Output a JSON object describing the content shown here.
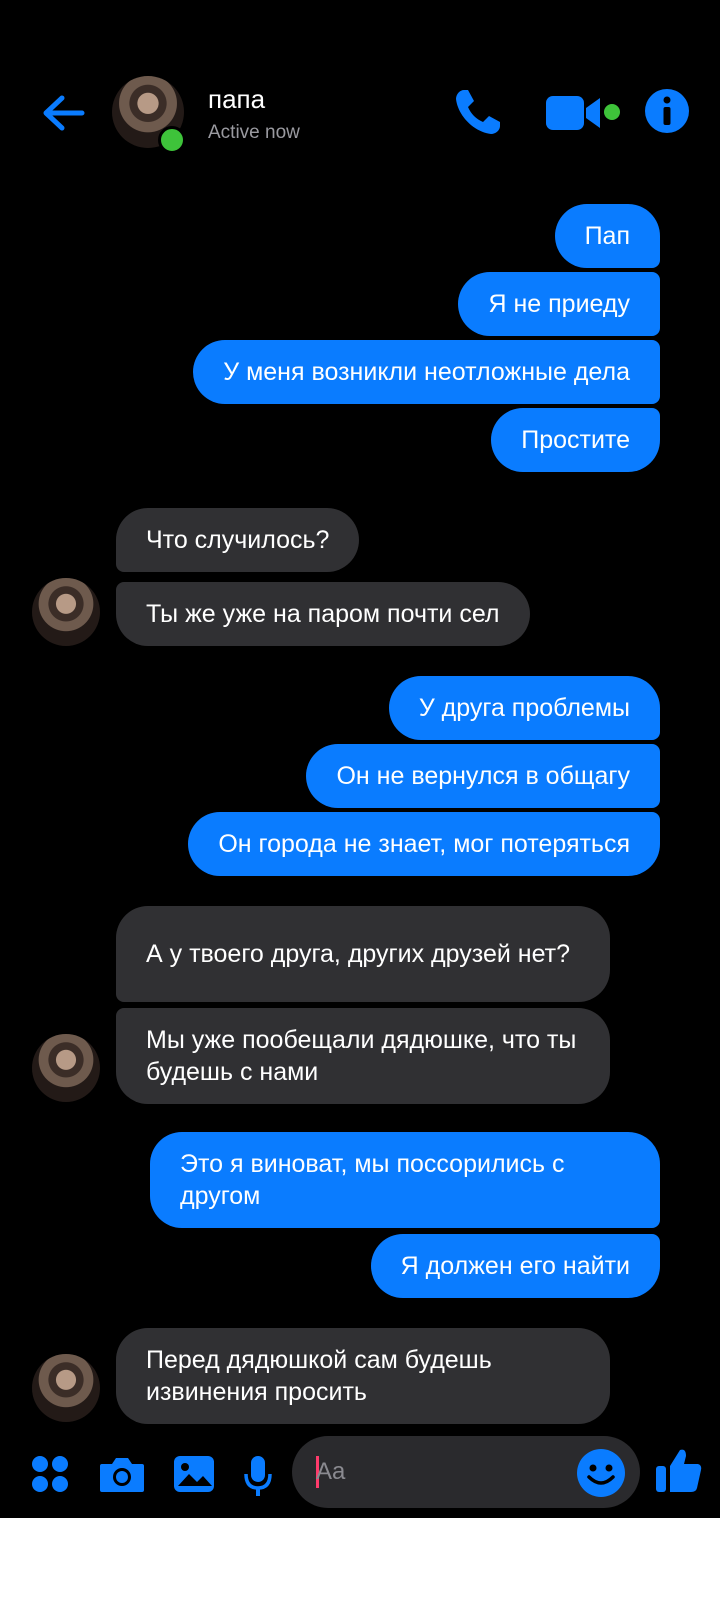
{
  "header": {
    "contact_name": "папа",
    "status": "Active now"
  },
  "messages": [
    {
      "id": "m1",
      "side": "out",
      "text": "Пап"
    },
    {
      "id": "m2",
      "side": "out",
      "text": "Я не приеду"
    },
    {
      "id": "m3",
      "side": "out",
      "text": "У меня возникли неотложные дела"
    },
    {
      "id": "m4",
      "side": "out",
      "text": "Простите"
    },
    {
      "id": "m5",
      "side": "in",
      "text": "Что случилось?"
    },
    {
      "id": "m6",
      "side": "in",
      "text": "Ты же уже на паром почти сел"
    },
    {
      "id": "m7",
      "side": "out",
      "text": "У друга проблемы"
    },
    {
      "id": "m8",
      "side": "out",
      "text": "Он не вернулся в общагу"
    },
    {
      "id": "m9",
      "side": "out",
      "text": "Он города не знает, мог потеряться"
    },
    {
      "id": "m10",
      "side": "in",
      "text": "А у твоего друга, других друзей нет?"
    },
    {
      "id": "m11",
      "side": "in",
      "text": "Мы уже пообещали дядюшке, что ты будешь с нами"
    },
    {
      "id": "m12",
      "side": "out",
      "text": "Это я виноват, мы поссорились с другом"
    },
    {
      "id": "m13",
      "side": "out",
      "text": "Я должен его найти"
    },
    {
      "id": "m14",
      "side": "in",
      "text": "Перед дядюшкой сам будешь извинения просить"
    }
  ],
  "composer": {
    "placeholder": "Aa"
  },
  "colors": {
    "accent": "#0a7cff",
    "incoming_bubble": "#303033",
    "online": "#3ec33a"
  },
  "icons": [
    "back-arrow-icon",
    "phone-icon",
    "video-icon",
    "info-icon",
    "apps-icon",
    "camera-icon",
    "gallery-icon",
    "microphone-icon",
    "emoji-icon",
    "thumbs-up-icon"
  ]
}
